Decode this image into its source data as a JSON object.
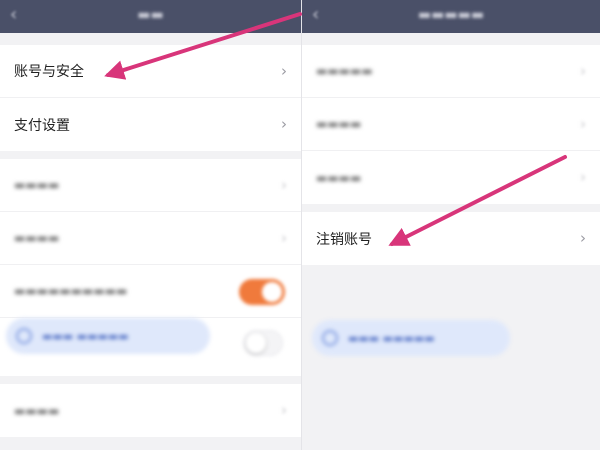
{
  "colors": {
    "navbar": "#4a5068",
    "arrow": "#d8357a",
    "toggle_on": "#f07a3c",
    "bubble_bg": "#dfe8fb"
  },
  "icons": {
    "back": "back-icon",
    "chevron": "chevron-right-icon",
    "bubble": "shield-icon"
  },
  "left": {
    "nav_back": "‹",
    "rows": [
      {
        "label": "账号与安全"
      },
      {
        "label": "支付设置"
      }
    ]
  },
  "right": {
    "nav_back": "‹",
    "rows": [
      {
        "label": "注销账号"
      }
    ]
  },
  "chevron": "›"
}
